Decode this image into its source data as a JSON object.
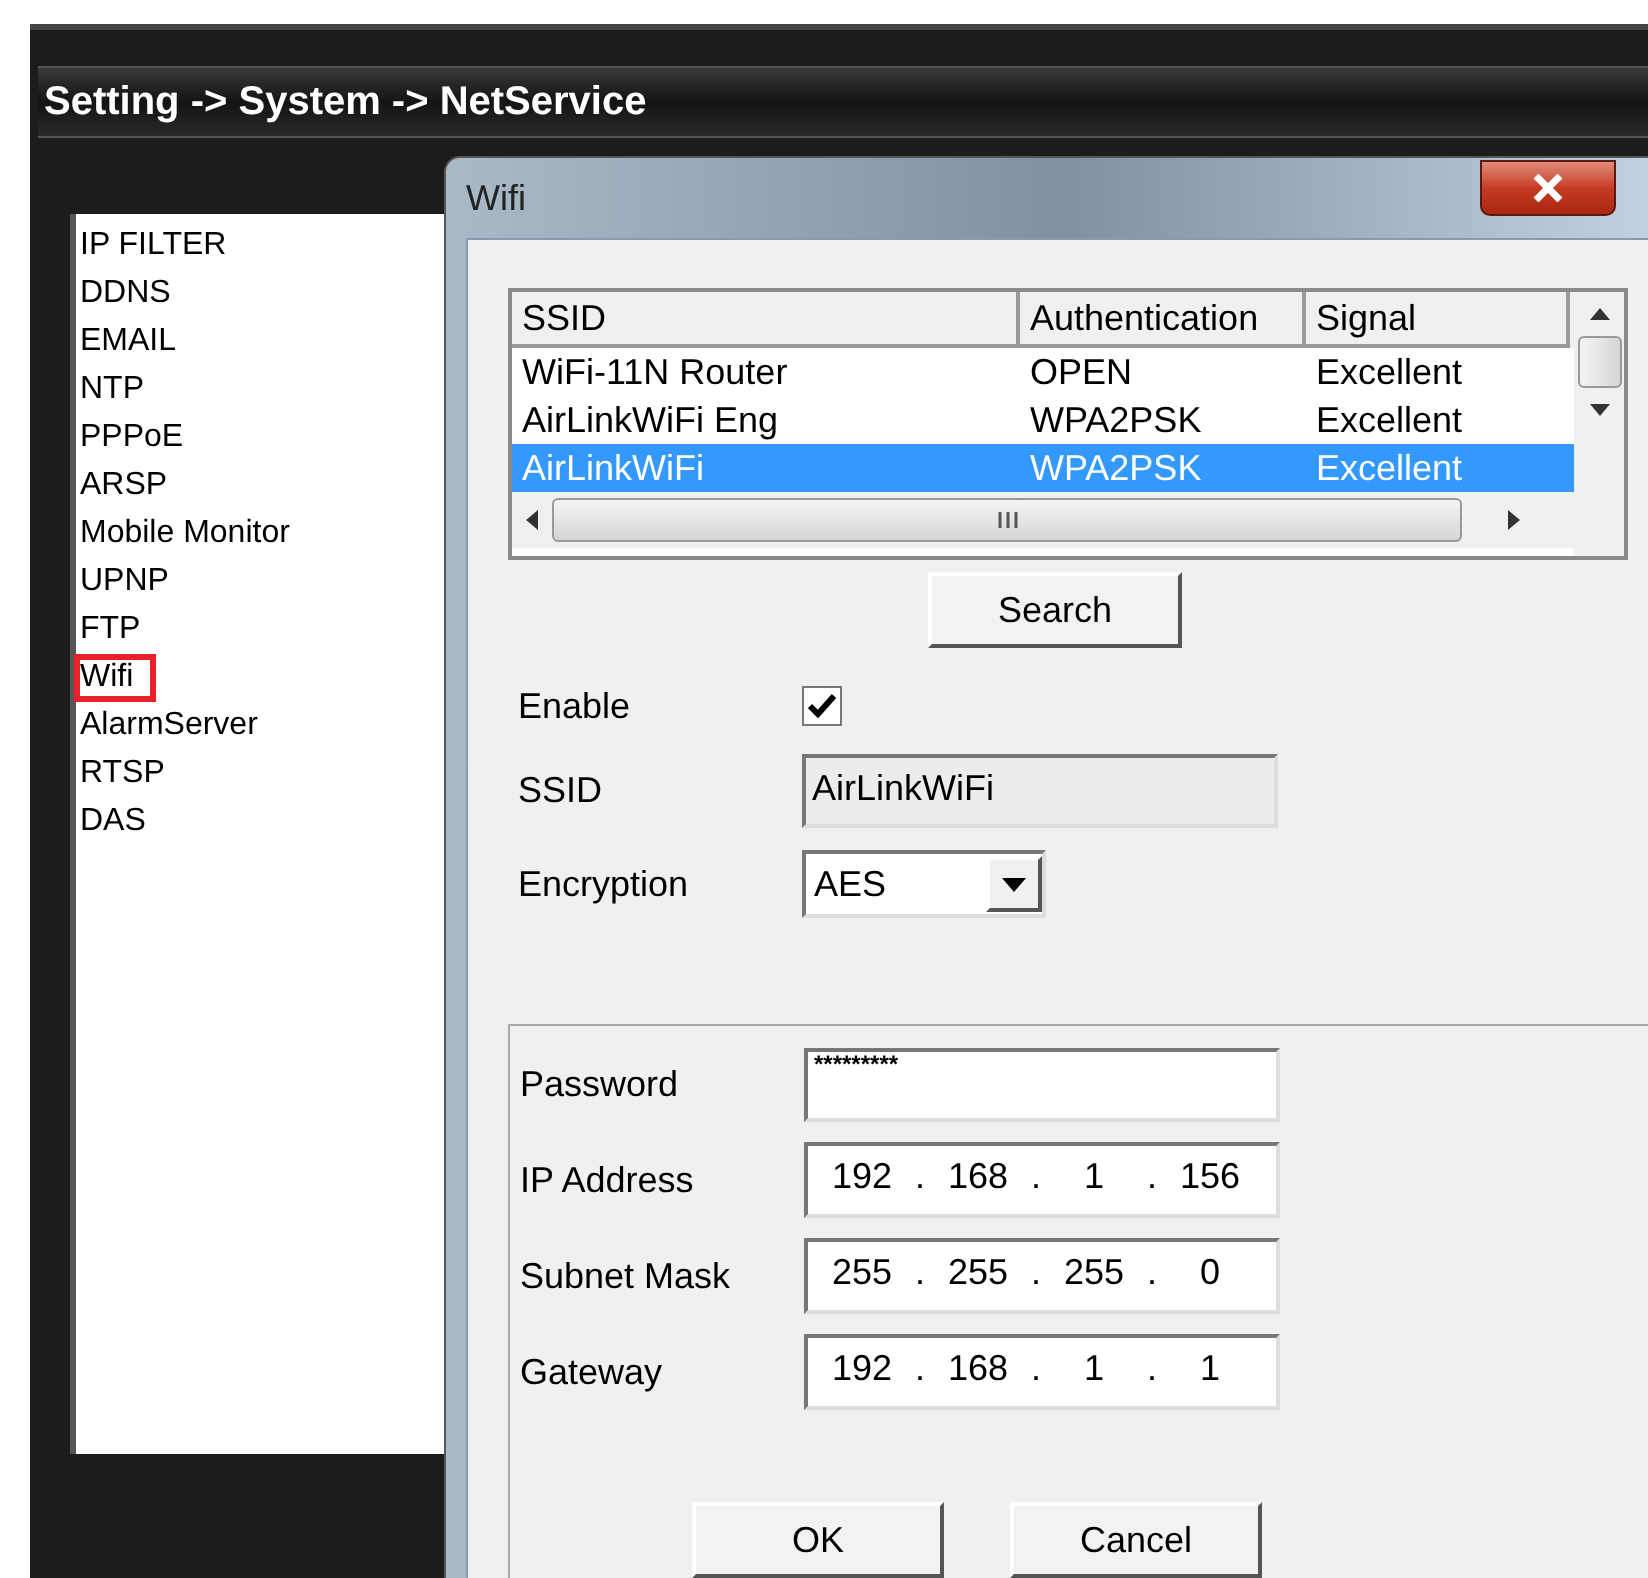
{
  "breadcrumb": "Setting -> System -> NetService",
  "menu": [
    {
      "label": "IP FILTER",
      "selected": false
    },
    {
      "label": "DDNS",
      "selected": false
    },
    {
      "label": "EMAIL",
      "selected": false
    },
    {
      "label": "NTP",
      "selected": false
    },
    {
      "label": "PPPoE",
      "selected": false
    },
    {
      "label": "ARSP",
      "selected": false
    },
    {
      "label": "Mobile Monitor",
      "selected": false
    },
    {
      "label": "UPNP",
      "selected": false
    },
    {
      "label": "FTP",
      "selected": false
    },
    {
      "label": "Wifi",
      "selected": true
    },
    {
      "label": "AlarmServer",
      "selected": false
    },
    {
      "label": "RTSP",
      "selected": false
    },
    {
      "label": "DAS",
      "selected": false
    }
  ],
  "dialog": {
    "title": "Wifi",
    "networks": {
      "columns": [
        "SSID",
        "Authentication",
        "Signal"
      ],
      "rows": [
        {
          "cells": [
            "WiFi-11N Router",
            "OPEN",
            "Excellent"
          ],
          "selected": false
        },
        {
          "cells": [
            "AirLinkWiFi Eng",
            "WPA2PSK",
            "Excellent"
          ],
          "selected": false
        },
        {
          "cells": [
            "AirLinkWiFi",
            "WPA2PSK",
            "Excellent"
          ],
          "selected": true
        }
      ]
    },
    "search_button": "Search",
    "enable": {
      "label": "Enable",
      "checked": true
    },
    "ssid": {
      "label": "SSID",
      "value": "AirLinkWiFi"
    },
    "encryption": {
      "label": "Encryption",
      "value": "AES"
    },
    "password": {
      "label": "Password",
      "value": "*********"
    },
    "address_fields": [
      {
        "label": "IP Address",
        "octets": [
          "192",
          "168",
          "1",
          "156"
        ],
        "separators": [
          ".",
          ".",
          "."
        ]
      },
      {
        "label": "Subnet Mask",
        "octets": [
          "255",
          "255",
          "255",
          "0"
        ],
        "separators": [
          ".",
          ".",
          "."
        ]
      },
      {
        "label": "Gateway",
        "octets": [
          "192",
          "168",
          "1",
          "1"
        ],
        "separators": [
          ".",
          ".",
          "."
        ]
      }
    ],
    "buttons": [
      "OK",
      "Cancel"
    ]
  }
}
